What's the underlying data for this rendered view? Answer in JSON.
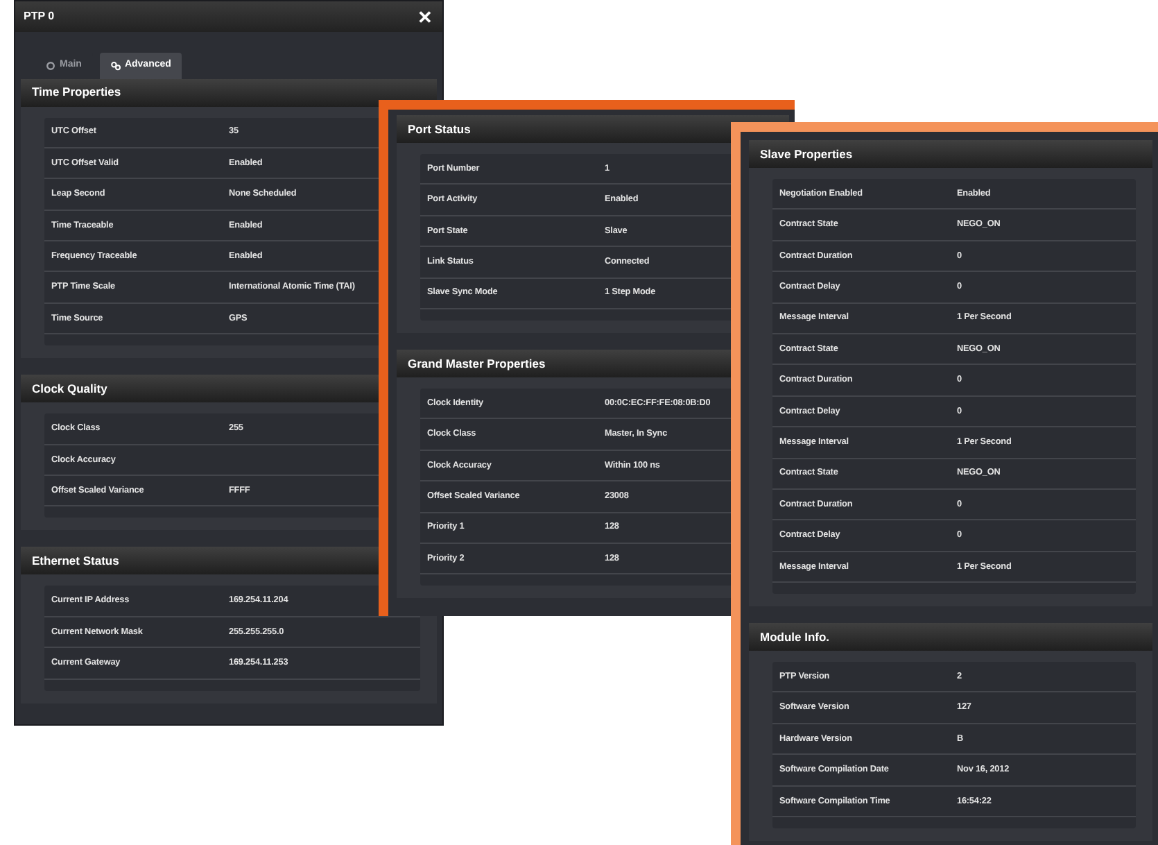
{
  "windows": [
    {
      "title": "PTP 0",
      "close": "✕",
      "tabs": [
        {
          "label": "Main",
          "selected": false
        },
        {
          "label": "Advanced",
          "selected": true
        }
      ],
      "sections": [
        {
          "title": "Time Properties",
          "rows": [
            {
              "label": "UTC Offset",
              "value": "35"
            },
            {
              "label": "UTC Offset Valid",
              "value": "Enabled"
            },
            {
              "label": "Leap Second",
              "value": "None Scheduled"
            },
            {
              "label": "Time Traceable",
              "value": "Enabled"
            },
            {
              "label": "Frequency Traceable",
              "value": "Enabled"
            },
            {
              "label": "PTP Time Scale",
              "value": "International Atomic Time (TAI)"
            },
            {
              "label": "Time Source",
              "value": "GPS"
            }
          ]
        },
        {
          "title": "Clock Quality",
          "rows": [
            {
              "label": "Clock Class",
              "value": "255"
            },
            {
              "label": "Clock Accuracy"
            },
            {
              "label": "Offset Scaled Variance",
              "value": "FFFF"
            }
          ]
        },
        {
          "title": "Ethernet Status",
          "rows": [
            {
              "label": "Current IP Address",
              "value": "169.254.11.204"
            },
            {
              "label": "Current Network Mask",
              "value": "255.255.255.0"
            },
            {
              "label": "Current Gateway",
              "value": "169.254.11.253"
            }
          ]
        }
      ]
    },
    {
      "color": "#e8601c",
      "sections": [
        {
          "title": "Port Status",
          "rows": [
            {
              "label": "Port Number",
              "value": "1"
            },
            {
              "label": "Port Activity",
              "value": "Enabled"
            },
            {
              "label": "Port State",
              "value": "Slave"
            },
            {
              "label": "Link Status",
              "value": "Connected"
            },
            {
              "label": "Slave Sync Mode",
              "value": "1 Step Mode"
            }
          ]
        },
        {
          "title": "Grand Master Properties",
          "rows": [
            {
              "label": "Clock Identity",
              "value": "00:0C:EC:FF:FE:08:0B:D0"
            },
            {
              "label": "Clock Class",
              "value": "Master, In Sync"
            },
            {
              "label": "Clock Accuracy",
              "value": "Within 100 ns"
            },
            {
              "label": "Offset Scaled Variance",
              "value": "23008"
            },
            {
              "label": "Priority 1",
              "value": "128"
            },
            {
              "label": "Priority 2",
              "value": "128"
            }
          ]
        }
      ]
    },
    {
      "color": "#f4935a",
      "sections": [
        {
          "title": "Slave Properties",
          "rows": [
            {
              "label": "Negotiation Enabled",
              "value": "Enabled"
            },
            {
              "label": "Contract State",
              "value": "NEGO_ON"
            },
            {
              "label": "Contract Duration",
              "value": "0"
            },
            {
              "label": "Contract Delay",
              "value": "0"
            },
            {
              "label": "Message Interval",
              "value": "1 Per Second"
            },
            {
              "label": "Contract State",
              "value": "NEGO_ON"
            },
            {
              "label": "Contract Duration",
              "value": "0"
            },
            {
              "label": "Contract Delay",
              "value": "0"
            },
            {
              "label": "Message Interval",
              "value": "1 Per Second"
            },
            {
              "label": "Contract State",
              "value": "NEGO_ON"
            },
            {
              "label": "Contract Duration",
              "value": "0"
            },
            {
              "label": "Contract Delay",
              "value": "0"
            },
            {
              "label": "Message Interval",
              "value": "1 Per Second"
            }
          ]
        },
        {
          "title": "Module Info.",
          "rows": [
            {
              "label": "PTP Version",
              "value": "2"
            },
            {
              "label": "Software Version",
              "value": "127"
            },
            {
              "label": "Hardware Version",
              "value": "B"
            },
            {
              "label": "Software Compilation Date",
              "value": "Nov 16, 2012"
            },
            {
              "label": "Software Compilation Time",
              "value": "16:54:22"
            }
          ]
        }
      ]
    }
  ]
}
